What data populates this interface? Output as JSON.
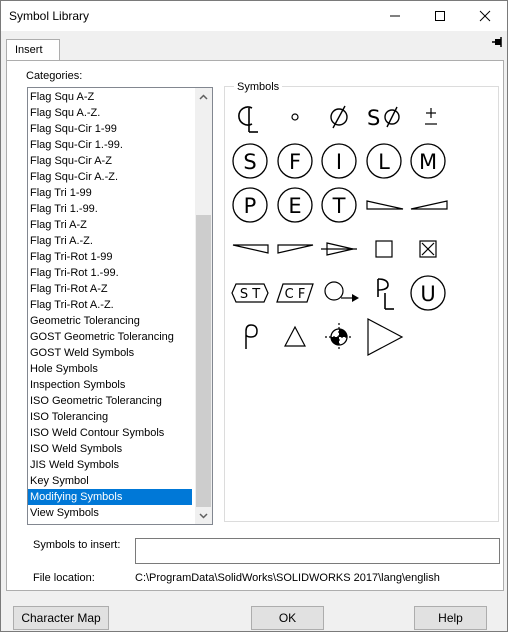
{
  "window": {
    "title": "Symbol Library",
    "controls": [
      "minimize-icon",
      "maximize-icon",
      "close-icon"
    ]
  },
  "tabs": [
    {
      "label": "Insert"
    }
  ],
  "pin_icon": "pin-icon",
  "categories": {
    "label": "Categories:",
    "items": [
      "Flag Squ A-Z",
      "Flag Squ A.-Z.",
      "Flag Squ-Cir 1-99",
      "Flag Squ-Cir 1.-99.",
      "Flag Squ-Cir A-Z",
      "Flag Squ-Cir A.-Z.",
      "Flag Tri 1-99",
      "Flag Tri 1.-99.",
      "Flag Tri A-Z",
      "Flag Tri A.-Z.",
      "Flag Tri-Rot 1-99",
      "Flag Tri-Rot 1.-99.",
      "Flag Tri-Rot A-Z",
      "Flag Tri-Rot A.-Z.",
      "Geometric Tolerancing",
      "GOST Geometric Tolerancing",
      "GOST Weld Symbols",
      "Hole Symbols",
      "Inspection Symbols",
      "ISO Geometric Tolerancing",
      "ISO Tolerancing",
      "ISO Weld Contour Symbols",
      "ISO Weld Symbols",
      "JIS Weld Symbols",
      "Key Symbol",
      "Modifying Symbols",
      "View Symbols"
    ],
    "selected": "Modifying Symbols"
  },
  "symbols": {
    "label": "Symbols",
    "circle_letters": [
      "S",
      "F",
      "I",
      "L",
      "M",
      "P",
      "E",
      "T",
      "U"
    ],
    "text_symbols": {
      "sf": "S",
      "st": "S T",
      "cf": "C F"
    },
    "items": [
      "centerline-symbol",
      "degree-symbol",
      "diameter-symbol",
      "spherical-diameter-symbol",
      "plus-minus-symbol",
      "circle-s-symbol",
      "circle-f-symbol",
      "circle-i-symbol",
      "circle-l-symbol",
      "circle-m-symbol",
      "circle-p-symbol",
      "circle-e-symbol",
      "circle-t-symbol",
      "slope-right-symbol",
      "slope-left-symbol",
      "taper-left-symbol",
      "taper-right-symbol",
      "conical-taper-symbol",
      "square-symbol",
      "square-x-symbol",
      "statistical-tolerance-symbol",
      "continuous-feature-symbol",
      "circle-arrow-symbol",
      "parting-line-symbol",
      "circle-u-symbol",
      "rho-symbol",
      "triangle-symbol",
      "center-of-gravity-symbol",
      "arrow-triangle-symbol"
    ]
  },
  "symbols_to_insert": {
    "label": "Symbols to insert:",
    "value": ""
  },
  "file_location": {
    "label": "File location:",
    "value": "C:\\ProgramData\\SolidWorks\\SOLIDWORKS 2017\\lang\\english"
  },
  "buttons": {
    "character_map": "Character Map",
    "ok": "OK",
    "help": "Help"
  },
  "colors": {
    "selection": "#0078d7",
    "window_bg": "#f0f0f0"
  }
}
